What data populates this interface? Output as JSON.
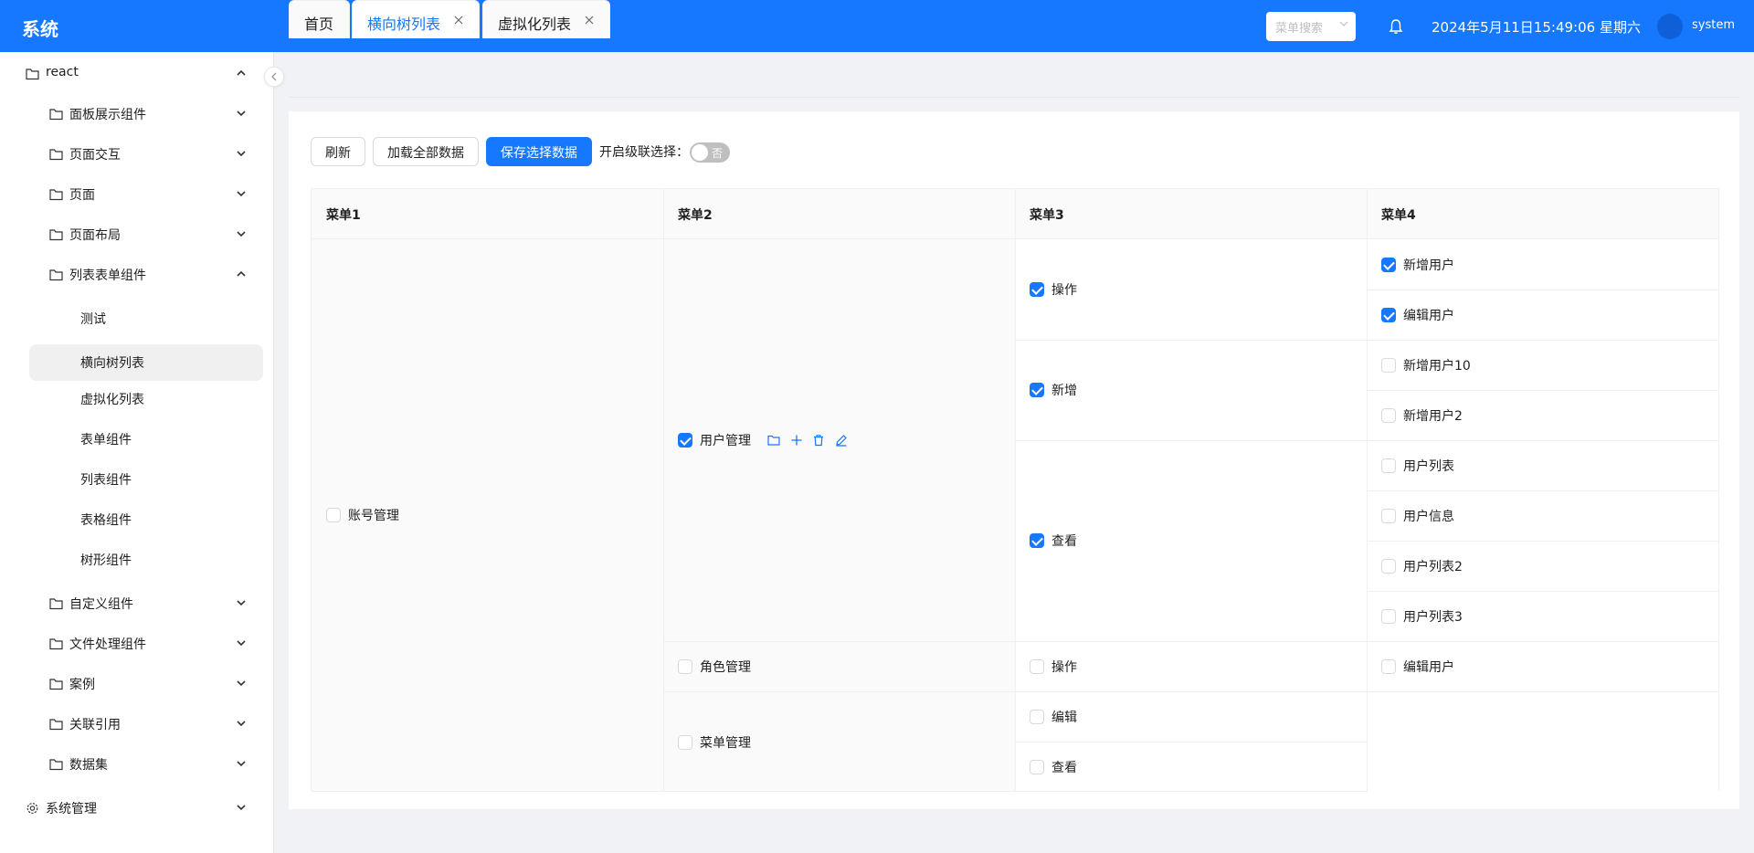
{
  "header": {
    "title": "系统",
    "search_placeholder": "菜单搜索",
    "datetime": "2024年5月11日15:49:06 星期六",
    "username": "system"
  },
  "sidebar": {
    "root": "react",
    "groups": [
      {
        "label": "面板展示组件"
      },
      {
        "label": "页面交互"
      },
      {
        "label": "页面"
      },
      {
        "label": "页面布局"
      },
      {
        "label": "列表表单组件"
      },
      {
        "label": "自定义组件"
      },
      {
        "label": "文件处理组件"
      },
      {
        "label": "案例"
      },
      {
        "label": "关联引用"
      },
      {
        "label": "数据集"
      }
    ],
    "sub_items": [
      "测试",
      "横向树列表",
      "虚拟化列表",
      "表单组件",
      "列表组件",
      "表格组件",
      "树形组件"
    ],
    "system": "系统管理"
  },
  "tabs": [
    {
      "label": "首页"
    },
    {
      "label": "横向树列表"
    },
    {
      "label": "虚拟化列表"
    }
  ],
  "toolbar": {
    "refresh": "刷新",
    "load_all": "加载全部数据",
    "save": "保存选择数据",
    "cascade_label": "开启级联选择：",
    "cascade_value": "否"
  },
  "table": {
    "headers": [
      "菜单1",
      "菜单2",
      "菜单3",
      "菜单4"
    ],
    "menu1": "账号管理",
    "menu2": [
      "用户管理",
      "角色管理",
      "菜单管理"
    ],
    "menu3": [
      "操作",
      "新增",
      "查看",
      "操作",
      "编辑",
      "查看"
    ],
    "menu4": [
      "新增用户",
      "编辑用户",
      "新增用户10",
      "新增用户2",
      "用户列表",
      "用户信息",
      "用户列表2",
      "用户列表3",
      "编辑用户"
    ]
  },
  "colors": {
    "primary": "#1677ff"
  }
}
